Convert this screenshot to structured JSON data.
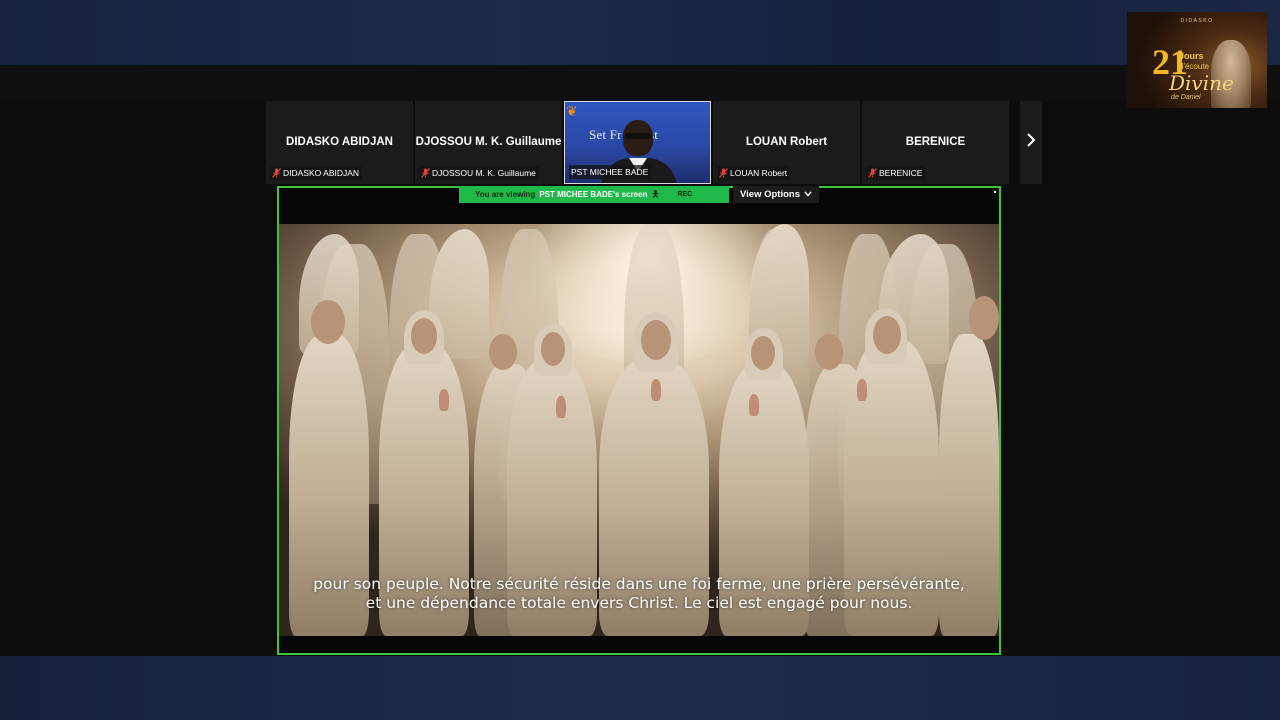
{
  "meeting": {
    "participants": [
      {
        "display_name": "DIDASKO ABIDJAN",
        "label": "DIDASKO ABIDJAN",
        "muted": true,
        "has_video": false
      },
      {
        "display_name": "DJOSSOU M. K. Guillaume",
        "label": "DJOSSOU M. K. Guillaume",
        "muted": true,
        "has_video": false
      },
      {
        "display_name": "",
        "label": "PST MICHEE BADE",
        "muted": false,
        "has_video": true,
        "video_text": "Set Fr   Christ"
      },
      {
        "display_name": "LOUAN Robert",
        "label": "LOUAN Robert",
        "muted": true,
        "has_video": false
      },
      {
        "display_name": "BERENICE",
        "label": "BERENICE",
        "muted": true,
        "has_video": false
      }
    ],
    "next_page_icon": "chevron-right-icon",
    "share_banner": {
      "prefix": "You are viewing",
      "presenter": "PST MICHEE BADE's screen",
      "rec": "REC"
    },
    "view_options_label": "View Options",
    "caption_lines": [
      "pour son peuple. Notre sécurité réside dans une foi ferme, une prière persévérante,",
      "et une dépendance totale envers Christ. Le ciel est engagé pour nous."
    ]
  },
  "logo": {
    "brand": "DIDASKO",
    "number": "21",
    "jours": "Jours",
    "ecoute": "d'écoute",
    "divine": "Divine",
    "daniel": "de Daniel"
  },
  "colors": {
    "share_border": "#3fc33f",
    "banner": "#1fb94a",
    "muted_icon": "#e0443a"
  }
}
